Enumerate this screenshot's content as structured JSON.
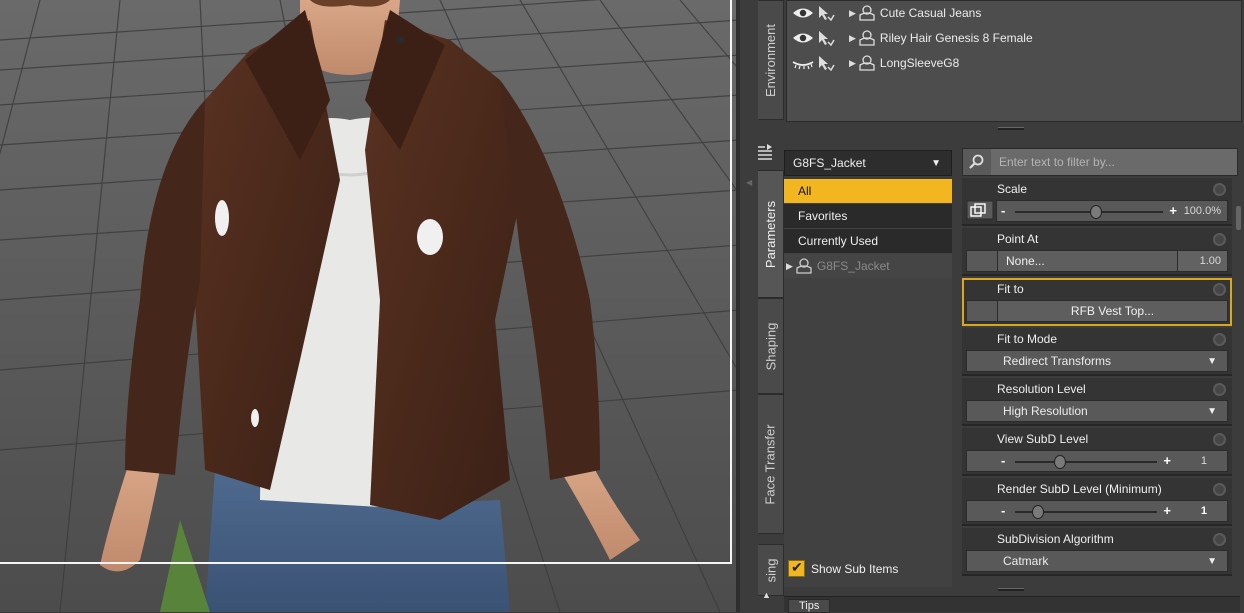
{
  "scene": {
    "items": [
      {
        "label": "Cute Casual Jeans",
        "eye_state": "visible"
      },
      {
        "label": "Riley Hair Genesis 8 Female",
        "eye_state": "visible"
      },
      {
        "label": "LongSleeveG8",
        "eye_state": "hidden"
      }
    ]
  },
  "side_tabs": {
    "environment": "Environment",
    "parameters": "Parameters",
    "shaping": "Shaping",
    "face_transfer": "Face Transfer",
    "posing": "sing"
  },
  "parameters": {
    "node_select": "G8FS_Jacket",
    "categories": [
      "All",
      "Favorites",
      "Currently Used"
    ],
    "selected_category": "All",
    "tree_node": "G8FS_Jacket",
    "filter_placeholder": "Enter text to filter by...",
    "show_sub_items": "Show Sub Items",
    "show_sub_items_checked": true,
    "props": {
      "scale": {
        "label": "Scale",
        "value": "100.0%",
        "level": 0.55
      },
      "point_at": {
        "label": "Point At",
        "button": "None...",
        "value": "1.00"
      },
      "fit_to": {
        "label": "Fit to",
        "button": "RFB Vest Top..."
      },
      "fit_to_mode": {
        "label": "Fit to Mode",
        "value": "Redirect Transforms"
      },
      "resolution_level": {
        "label": "Resolution Level",
        "value": "High Resolution"
      },
      "view_subd": {
        "label": "View SubD Level",
        "value": "1",
        "level": 0.32
      },
      "render_subd": {
        "label": "Render SubD Level (Minimum)",
        "value": "1",
        "level": 0.16
      },
      "subd_algorithm": {
        "label": "SubDivision Algorithm",
        "value": "Catmark"
      }
    }
  },
  "bottom": {
    "tips": "Tips"
  },
  "colors": {
    "accent": "#f2b620",
    "panel_bg": "#3c3c3c",
    "jacket": "#4e2a1c"
  }
}
